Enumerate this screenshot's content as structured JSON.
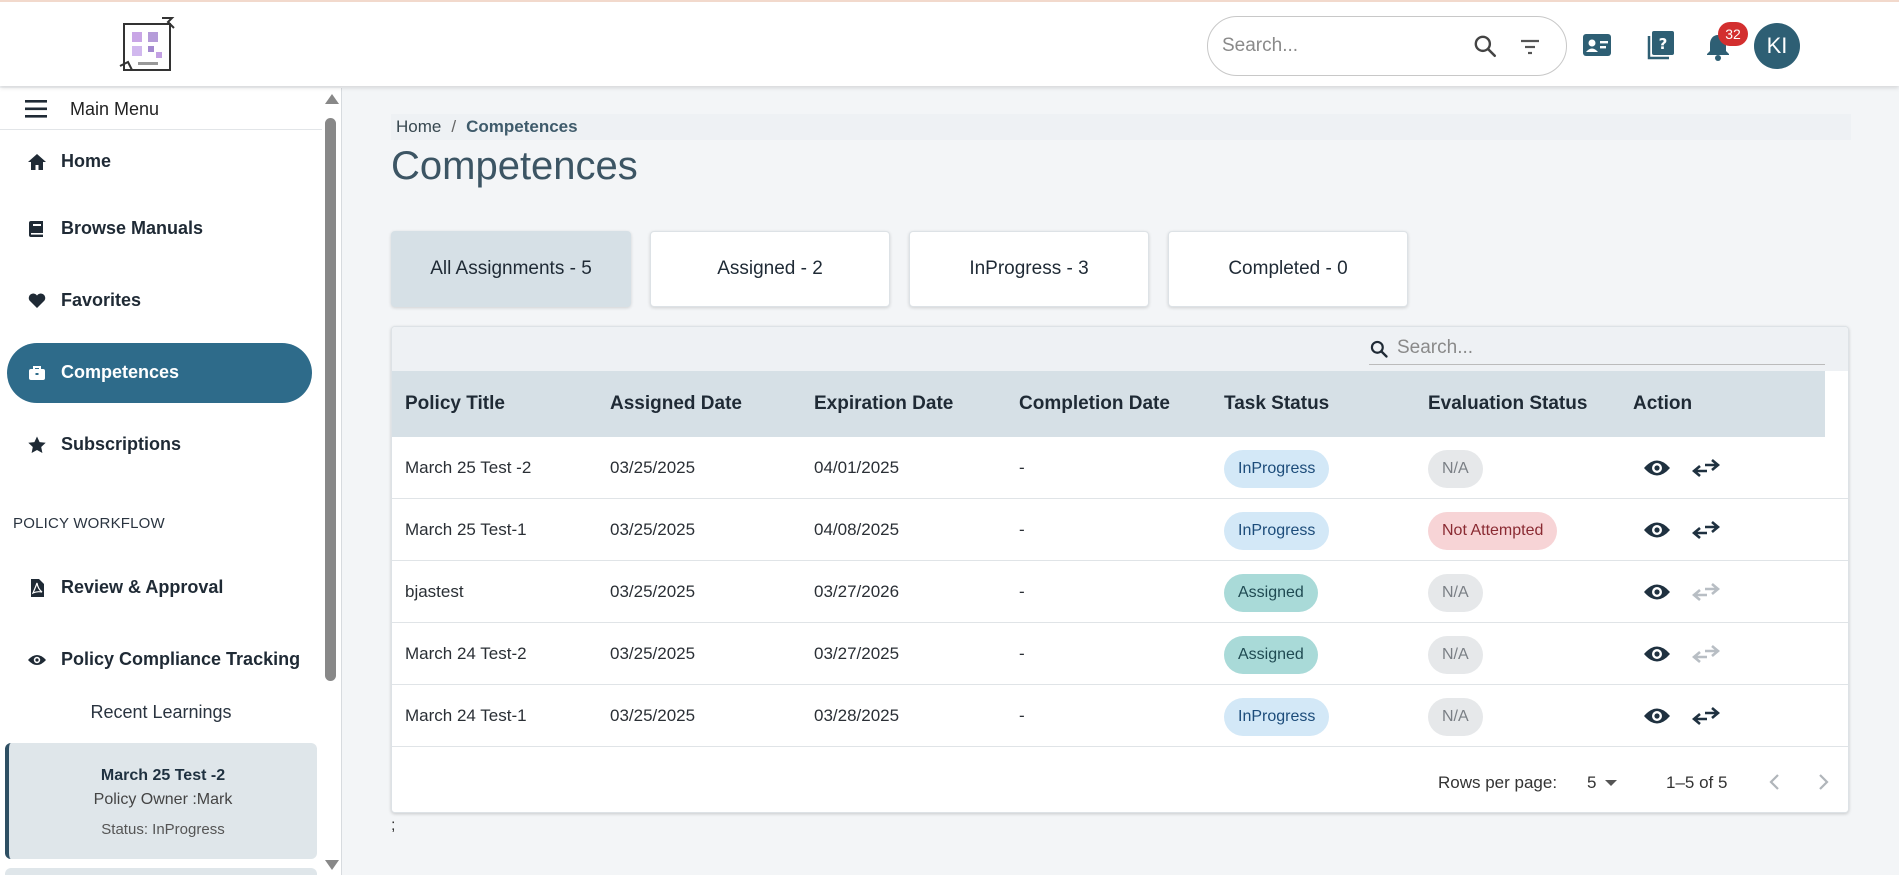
{
  "header": {
    "search_placeholder": "Search...",
    "notification_count": "32",
    "avatar_initials": "KI"
  },
  "sidebar": {
    "main_menu_label": "Main Menu",
    "items": [
      {
        "label": "Home",
        "icon": "home-icon"
      },
      {
        "label": "Browse Manuals",
        "icon": "book-icon"
      },
      {
        "label": "Favorites",
        "icon": "heart-icon"
      },
      {
        "label": "Competences",
        "icon": "briefcase-icon",
        "active": true
      },
      {
        "label": "Subscriptions",
        "icon": "star-icon"
      }
    ],
    "section_title": "POLICY WORKFLOW",
    "workflow_items": [
      {
        "label": "Review & Approval",
        "icon": "pdf-file-icon"
      },
      {
        "label": "Policy Compliance Tracking",
        "icon": "eye-icon"
      }
    ],
    "recent_title": "Recent Learnings",
    "recent": [
      {
        "title": "March 25 Test -2",
        "owner": "Policy Owner :Mark",
        "status": "Status: InProgress"
      }
    ]
  },
  "breadcrumb": {
    "home": "Home",
    "separator": "/",
    "current": "Competences"
  },
  "page_title": "Competences",
  "tabs": [
    {
      "label": "All Assignments - 5",
      "active": true
    },
    {
      "label": "Assigned - 2"
    },
    {
      "label": "InProgress - 3"
    },
    {
      "label": "Completed - 0"
    }
  ],
  "table": {
    "search_placeholder": "Search...",
    "columns": [
      "Policy Title",
      "Assigned Date",
      "Expiration Date",
      "Completion Date",
      "Task Status",
      "Evaluation Status",
      "Action"
    ],
    "rows": [
      {
        "title": "March 25 Test -2",
        "assigned": "03/25/2025",
        "expiration": "04/01/2025",
        "completion": "-",
        "task_status": "InProgress",
        "eval_status": "N/A"
      },
      {
        "title": "March 25 Test-1",
        "assigned": "03/25/2025",
        "expiration": "04/08/2025",
        "completion": "-",
        "task_status": "InProgress",
        "eval_status": "Not Attempted"
      },
      {
        "title": "bjastest",
        "assigned": "03/25/2025",
        "expiration": "03/27/2026",
        "completion": "-",
        "task_status": "Assigned",
        "eval_status": "N/A"
      },
      {
        "title": "March 24 Test-2",
        "assigned": "03/25/2025",
        "expiration": "03/27/2025",
        "completion": "-",
        "task_status": "Assigned",
        "eval_status": "N/A"
      },
      {
        "title": "March 24 Test-1",
        "assigned": "03/25/2025",
        "expiration": "03/28/2025",
        "completion": "-",
        "task_status": "InProgress",
        "eval_status": "N/A"
      }
    ],
    "footer": {
      "rows_per_page_label": "Rows per page:",
      "rows_per_page": "5",
      "range": "1–5 of 5"
    }
  },
  "trailing_text": ";",
  "colors": {
    "accent": "#2e6b8a",
    "header_row": "#d6e0e6",
    "badge": "#d32f2f",
    "avatar": "#2e5f74"
  }
}
